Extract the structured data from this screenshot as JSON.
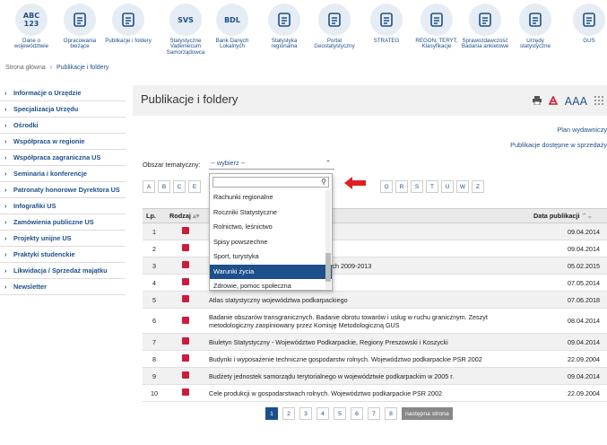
{
  "nav": [
    {
      "label": "Dane o województwie",
      "icon": "abc-123-icon",
      "glyph": "ABC 123"
    },
    {
      "label": "Opracowania bieżące",
      "icon": "chat-icon",
      "glyph": ""
    },
    {
      "label": "Publikacje i foldery",
      "icon": "document-list-icon",
      "glyph": ""
    },
    {
      "label": "Statystyczne Vademecum Samorządowca",
      "icon": "svs-icon",
      "glyph": "SVS"
    },
    {
      "label": "Bank Danych Lokalnych",
      "icon": "bdl-icon",
      "glyph": "BDL"
    },
    {
      "label": "Statystyka regionalna",
      "icon": "network-icon",
      "glyph": ""
    },
    {
      "label": "Portal Geostatystyczny",
      "icon": "globe-icon",
      "glyph": ""
    },
    {
      "label": "STRATEG",
      "icon": "strateg-icon",
      "glyph": ""
    },
    {
      "label": "REGON, TERYT, Klasyfikacje",
      "icon": "registry-icon",
      "glyph": ""
    },
    {
      "label": "Sprawozdawczość Badania ankietowe",
      "icon": "chart-icon",
      "glyph": ""
    },
    {
      "label": "Urzędy statystyczne",
      "icon": "office-icon",
      "glyph": ""
    },
    {
      "label": "GUS",
      "icon": "gus-icon",
      "glyph": ""
    }
  ],
  "breadcrumb": {
    "home": "Strona główna",
    "sep": "›",
    "current": "Publikacje i foldery"
  },
  "sidebar": [
    "Informacje o Urzędzie",
    "Specjalizacja Urzędu",
    "Ośrodki",
    "Współpraca w regionie",
    "Współpraca zagraniczna US",
    "Seminaria i konferencje",
    "Patronaty honorowe Dyrektora US",
    "Infografiki US",
    "Zamówienia publiczne US",
    "Projekty unijne US",
    "Praktyki studenckie",
    "Likwidacja / Sprzedaż majątku",
    "Newsletter"
  ],
  "page": {
    "title": "Publikacje i foldery",
    "font_size_label": "AAA",
    "plan_link": "Plan wydawniczy",
    "sale_link": "Publikacje dostępne w sprzedaży",
    "filter_label": "Obszar tematyczny:",
    "filter_value": "-- wybierz --"
  },
  "letters_left": [
    "A",
    "B",
    "C",
    "E"
  ],
  "letters_right": [
    "O",
    "R",
    "S",
    "T",
    "U",
    "W",
    "Z"
  ],
  "dropdown": {
    "options": [
      "Rachunki regionalne",
      "Roczniki Statystyczne",
      "Rolnictwo, leśnictwo",
      "Spisy powszechne",
      "Sport, turystyka",
      "Warunki życia",
      "Zdrowie, pomoc społeczna"
    ],
    "selected_index": 5
  },
  "table": {
    "headers": {
      "lp": "Lp.",
      "kind": "Rodzaj",
      "date": "Data publikacji"
    },
    "rows": [
      {
        "lp": "1",
        "title": "ojewództwie podkarpackim. NSP 2011",
        "date": "09.04.2014"
      },
      {
        "lp": "2",
        "title": "ojewództwo podkarpackie NSP 2002",
        "date": "09.04.2014"
      },
      {
        "lp": "3",
        "title": "czego województwa podkarpackiego w latach 2009-2013",
        "date": "05.02.2015"
      },
      {
        "lp": "4",
        "title": "czej pogranicza polsko-ukraińskiego",
        "date": "07.05.2014"
      },
      {
        "lp": "5",
        "title": "Atlas statystyczny województwa podkarpackiego",
        "date": "07.06.2018"
      },
      {
        "lp": "6",
        "title": "Badanie obszarów transgranicznych. Badanie obrotu towarów i usług w ruchu granicznym. Zeszyt metodologiczny zaopiniowany przez Komisję Metodologiczną GUS",
        "date": "08.04.2014"
      },
      {
        "lp": "7",
        "title": "Biuletyn Statystyczny - Województwo Podkarpackie, Regiony Preszowski i Koszycki",
        "date": "09.04.2014"
      },
      {
        "lp": "8",
        "title": "Budynki i wyposażenie techniczne gospodarstw rolnych. Województwo podkarpackie PSR 2002",
        "date": "22.09.2004"
      },
      {
        "lp": "9",
        "title": "Budżety jednostek samorządu terytorialnego w województwie podkarpackim w 2005 r.",
        "date": "09.04.2014"
      },
      {
        "lp": "10",
        "title": "Cele produkcji w gospodarstwach rolnych. Województwo podkarpackie PSR 2002",
        "date": "22.09.2004"
      }
    ]
  },
  "pager": {
    "pages": [
      "1",
      "2",
      "3",
      "4",
      "5",
      "6",
      "7",
      "8"
    ],
    "next": "następna strona"
  },
  "colors": {
    "accent": "#1d4f8b",
    "pdf": "#c81e3c",
    "arrow": "#e02020"
  }
}
